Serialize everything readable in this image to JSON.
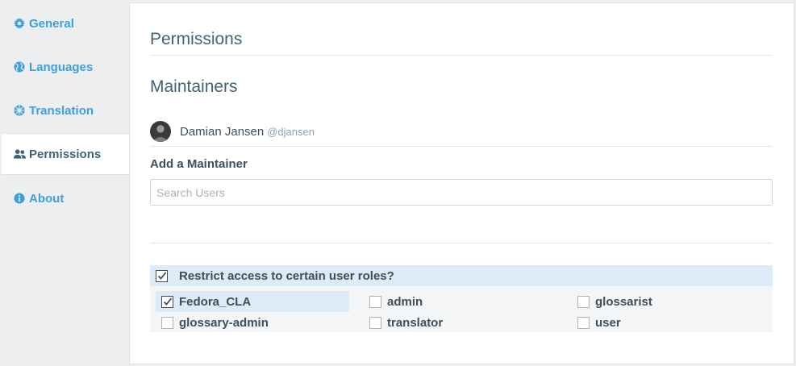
{
  "sidebar": {
    "items": [
      {
        "label": "General",
        "icon": "gear-icon"
      },
      {
        "label": "Languages",
        "icon": "globe-icon"
      },
      {
        "label": "Translation",
        "icon": "translate-icon"
      },
      {
        "label": "Permissions",
        "icon": "users-icon",
        "active": true
      },
      {
        "label": "About",
        "icon": "info-icon"
      }
    ]
  },
  "main": {
    "title": "Permissions",
    "maintainers_heading": "Maintainers",
    "maintainer": {
      "name": "Damian Jansen",
      "handle": "@djansen"
    },
    "add_label": "Add a Maintainer",
    "search_placeholder": "Search Users",
    "restrict": {
      "label": "Restrict access to certain user roles?",
      "checked": true
    },
    "roles": [
      {
        "name": "Fedora_CLA",
        "checked": true
      },
      {
        "name": "admin",
        "checked": false
      },
      {
        "name": "glossarist",
        "checked": false
      },
      {
        "name": "glossary-admin",
        "checked": false
      },
      {
        "name": "translator",
        "checked": false
      },
      {
        "name": "user",
        "checked": false
      }
    ]
  },
  "colors": {
    "accent": "#3d9fdc",
    "heading": "#416376",
    "highlight": "#dcebf7"
  }
}
